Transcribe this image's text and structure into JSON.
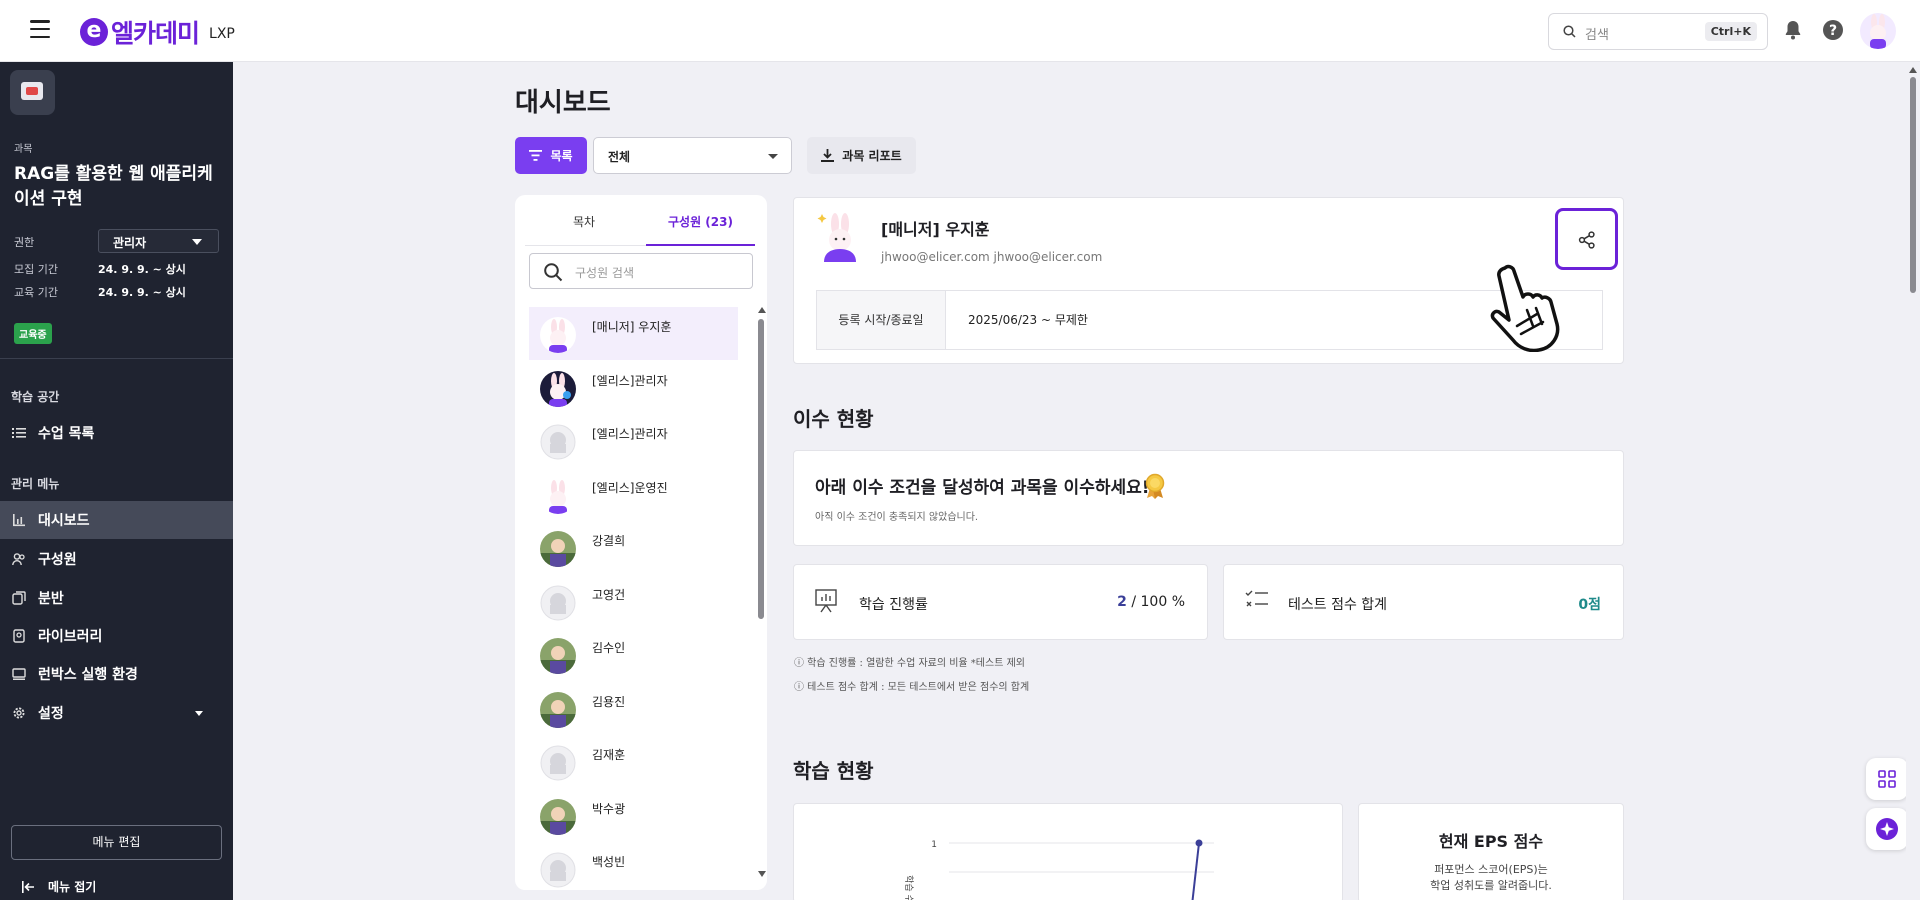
{
  "header": {
    "logo_mark": "e",
    "logo_text": "엘카데미",
    "logo_sub": "LXP",
    "search_placeholder": "검색",
    "search_shortcut": "Ctrl+K"
  },
  "sidebar": {
    "course_caption": "과목",
    "course_title": "RAG를 활용한 웹 애플리케이션 구현",
    "role_label": "권한",
    "role_value": "관리자",
    "recruit_label": "모집 기간",
    "recruit_value": "24. 9. 9. ~ 상시",
    "edu_label": "교육 기간",
    "edu_value": "24. 9. 9. ~ 상시",
    "status_badge": "교육중",
    "section_learning": "학습 공간",
    "section_admin": "관리 메뉴",
    "items": [
      {
        "label": "수업 목록",
        "icon": "list-icon"
      },
      {
        "label": "대시보드",
        "icon": "bar-chart-icon",
        "active": true
      },
      {
        "label": "구성원",
        "icon": "users-icon"
      },
      {
        "label": "분반",
        "icon": "class-icon"
      },
      {
        "label": "라이브러리",
        "icon": "library-icon"
      },
      {
        "label": "런박스 실행 환경",
        "icon": "monitor-icon"
      },
      {
        "label": "설정",
        "icon": "gear-icon"
      }
    ],
    "menu_edit": "메뉴 편집",
    "menu_fold": "메뉴 접기"
  },
  "main": {
    "title": "대시보드",
    "list_button": "목록",
    "filter_value": "전체",
    "report_button": "과목 리포트"
  },
  "members": {
    "tab_toc": "목차",
    "tab_members": "구성원 (23)",
    "search_placeholder": "구성원 검색",
    "list": [
      {
        "name": "[매니저] 우지훈",
        "avatar": "rabbit"
      },
      {
        "name": "[엘리스]관리자",
        "avatar": "rabbit-dark"
      },
      {
        "name": "[엘리스]관리자",
        "avatar": "default"
      },
      {
        "name": "[엘리스]운영진",
        "avatar": "rabbit"
      },
      {
        "name": "강결희",
        "avatar": "photo"
      },
      {
        "name": "고영건",
        "avatar": "default"
      },
      {
        "name": "김수인",
        "avatar": "photo"
      },
      {
        "name": "김용진",
        "avatar": "photo"
      },
      {
        "name": "김재훈",
        "avatar": "default"
      },
      {
        "name": "박수광",
        "avatar": "photo"
      },
      {
        "name": "백성빈",
        "avatar": "default"
      }
    ]
  },
  "profile": {
    "name": "[매니저] 우지훈",
    "email": "jhwoo@elicer.com  jhwoo@elicer.com",
    "period_label": "등록 시작/종료일",
    "period_value": "2025/06/23 ~ 무제한"
  },
  "completion": {
    "section_title": "이수 현황",
    "headline": "아래 이수 조건을 달성하여 과목을 이수하세요!",
    "sub": "아직 이수 조건이 충족되지 않았습니다.",
    "progress_label": "학습 진행률",
    "progress_value": "2",
    "progress_suffix": " / 100 %",
    "test_label": "테스트 점수 합계",
    "test_value": "0점",
    "note1": "ⓘ 학습 진행률 : 열람한 수업 자료의 비율 *테스트 제외",
    "note2": "ⓘ 테스트 점수 합계 : 모든 테스트에서 받은 점수의 합계"
  },
  "learning": {
    "section_title": "학습 현황",
    "eps_title": "현재 EPS 점수",
    "eps_desc1": "퍼포먼스 스코어(EPS)는",
    "eps_desc2": "학업 성취도를 알려줍니다."
  },
  "chart_data": {
    "type": "line",
    "y_tick_labels": [
      "1"
    ],
    "ylabel": "학습 수",
    "series": [
      {
        "values": [
          1
        ]
      }
    ]
  },
  "colors": {
    "accent": "#6b22d8",
    "sidebar_bg": "#1f2330",
    "badge_green": "#2ba24c",
    "progress_blue": "#3b3f98",
    "test_teal": "#1f8a8a"
  }
}
